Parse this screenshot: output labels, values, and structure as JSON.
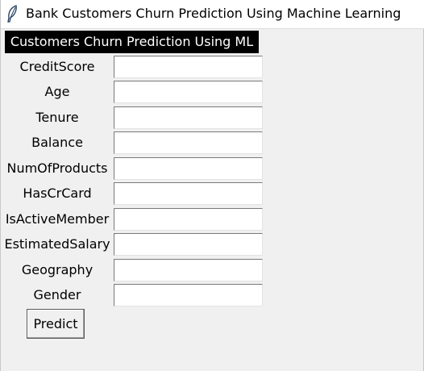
{
  "window": {
    "title": "Bank Customers Churn Prediction Using Machine Learning",
    "icon": "feather-icon"
  },
  "header": {
    "title": "Customers Churn Prediction Using ML"
  },
  "form": {
    "fields": [
      {
        "label": "CreditScore",
        "value": ""
      },
      {
        "label": "Age",
        "value": ""
      },
      {
        "label": "Tenure",
        "value": ""
      },
      {
        "label": "Balance",
        "value": ""
      },
      {
        "label": "NumOfProducts",
        "value": ""
      },
      {
        "label": "HasCrCard",
        "value": ""
      },
      {
        "label": "IsActiveMember",
        "value": ""
      },
      {
        "label": "EstimatedSalary",
        "value": ""
      },
      {
        "label": "Geography",
        "value": ""
      },
      {
        "label": "Gender",
        "value": ""
      }
    ],
    "submit_label": "Predict"
  },
  "colors": {
    "window_bg": "#f0f0f0",
    "banner_bg": "#000000",
    "banner_text": "#ffffff"
  }
}
